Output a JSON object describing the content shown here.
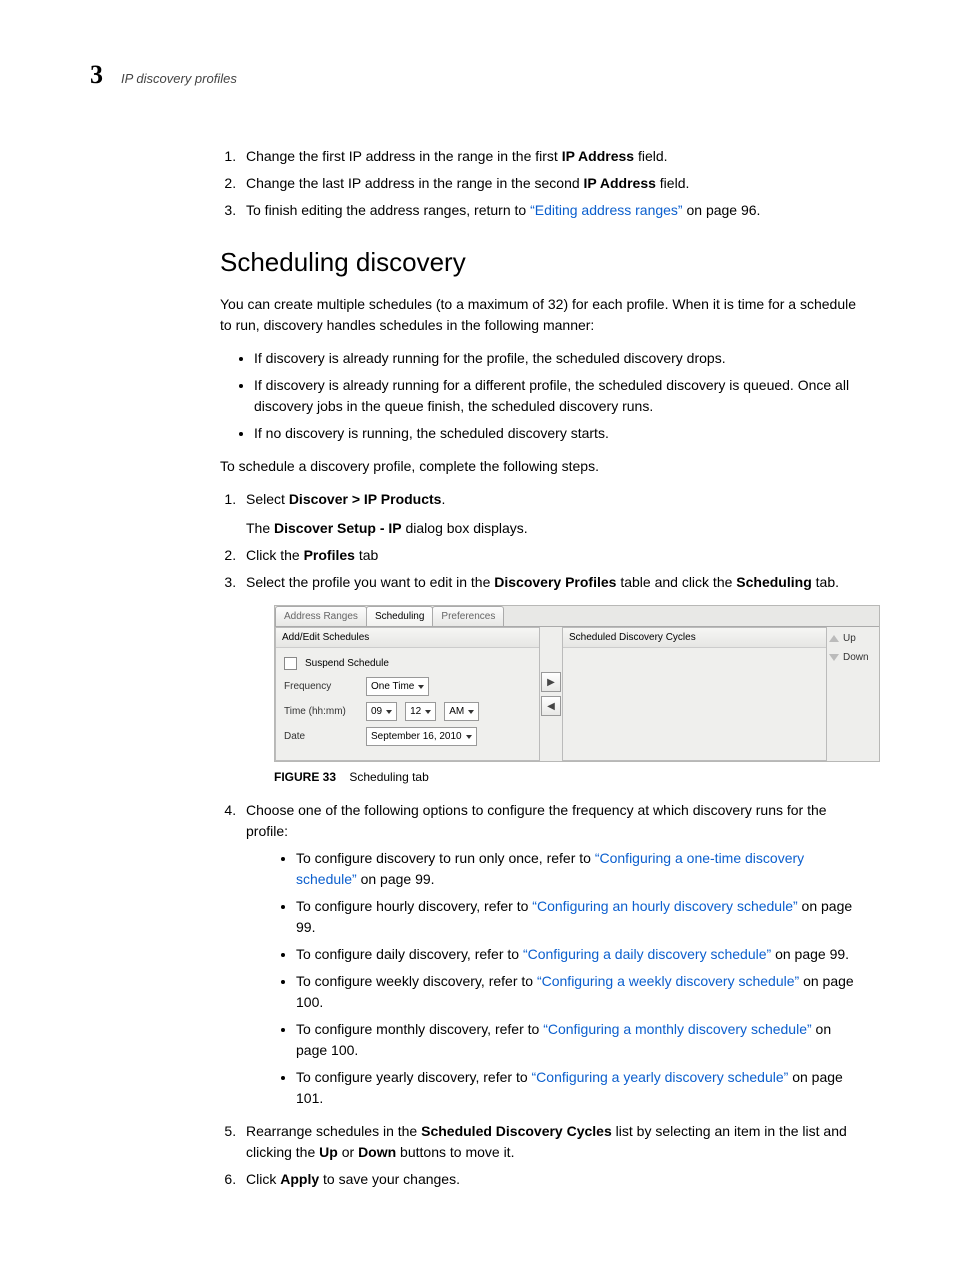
{
  "header": {
    "chapter_number": "3",
    "running_title": "IP discovery profiles"
  },
  "intro_steps": [
    {
      "before": "Change the first IP address in the range in the first ",
      "bold": "IP Address",
      "after": " field."
    },
    {
      "before": "Change the last IP address in the range in the second ",
      "bold": "IP Address",
      "after": " field."
    },
    {
      "before": "To finish editing the address ranges, return to ",
      "link": "“Editing address ranges”",
      "after": " on page 96."
    }
  ],
  "section_title": "Scheduling discovery",
  "para1": "You can create multiple schedules (to a maximum of 32) for each profile. When it is time for a schedule to run, discovery handles schedules in the following manner:",
  "bullets1": [
    "If discovery is already running for the profile, the scheduled discovery drops.",
    "If discovery is already running for a different profile, the scheduled discovery is queued. Once all discovery jobs in the queue finish, the scheduled discovery runs.",
    "If no discovery is running, the scheduled discovery starts."
  ],
  "para2": "To schedule a discovery profile, complete the following steps.",
  "steps": {
    "s1": {
      "before": "Select ",
      "bold": "Discover > IP Products",
      "after": ".",
      "sub_before": "The ",
      "sub_bold": "Discover Setup - IP",
      "sub_after": " dialog box displays."
    },
    "s2": {
      "before": "Click the ",
      "bold": "Profiles",
      "after": " tab"
    },
    "s3": {
      "before": "Select the profile you want to edit in the ",
      "bold1": "Discovery Profiles",
      "mid": " table and click the ",
      "bold2": "Scheduling",
      "after": " tab."
    },
    "s4_intro": "Choose one of the following options to configure the frequency at which discovery runs for the profile:",
    "s4_items": [
      {
        "before": "To configure discovery to run only once, refer to ",
        "link": "“Configuring a one-time discovery schedule”",
        "after": " on page 99."
      },
      {
        "before": "To configure hourly discovery, refer to ",
        "link": "“Configuring an hourly discovery schedule”",
        "after": " on page 99."
      },
      {
        "before": "To configure daily discovery, refer to ",
        "link": "“Configuring a daily discovery schedule”",
        "after": " on page 99."
      },
      {
        "before": "To configure weekly discovery, refer to ",
        "link": "“Configuring a weekly discovery schedule”",
        "after": " on page 100."
      },
      {
        "before": "To configure monthly discovery, refer to ",
        "link": "“Configuring a monthly discovery schedule”",
        "after": " on page 100."
      },
      {
        "before": "To configure yearly discovery, refer to ",
        "link": "“Configuring a yearly discovery schedule”",
        "after": " on page 101."
      }
    ],
    "s5": {
      "before": "Rearrange schedules in the ",
      "bold1": "Scheduled Discovery Cycles",
      "mid": " list by selecting an item in the list and clicking the ",
      "bold2": "Up",
      "mid2": " or ",
      "bold3": "Down",
      "after": " buttons to move it."
    },
    "s6": {
      "before": "Click ",
      "bold": "Apply",
      "after": " to save your changes."
    }
  },
  "figure": {
    "tabs": {
      "t1": "Address Ranges",
      "t2": "Scheduling",
      "t3": "Preferences"
    },
    "left_panel_title": "Add/Edit Schedules",
    "right_panel_title": "Scheduled Discovery Cycles",
    "suspend_label": "Suspend Schedule",
    "freq_label": "Frequency",
    "freq_value": "One Time",
    "time_label": "Time (hh:mm)",
    "time_h": "09",
    "time_m": "12",
    "time_ampm": "AM",
    "date_label": "Date",
    "date_value": "September 16, 2010",
    "btn_up": "Up",
    "btn_down": "Down",
    "caption_num": "FIGURE 33",
    "caption_text": "Scheduling tab"
  }
}
